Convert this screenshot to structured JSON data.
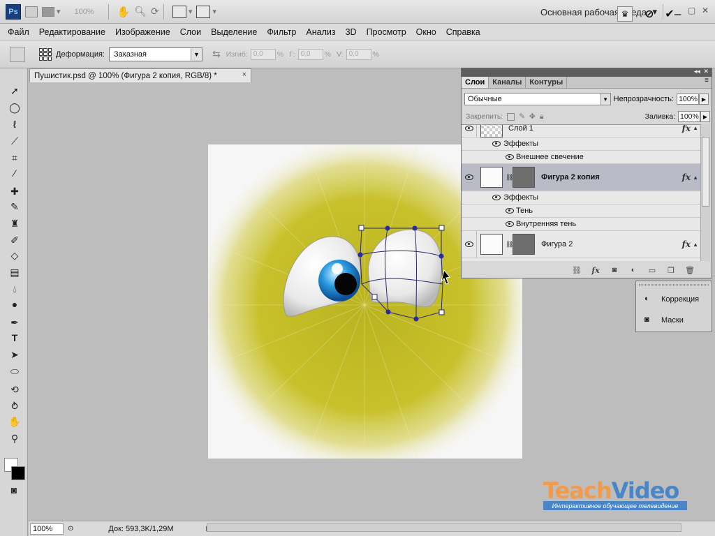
{
  "app": {
    "logo": "Ps",
    "zoom": "100%",
    "workspace": "Основная рабочая среда"
  },
  "menu": [
    "Файл",
    "Редактирование",
    "Изображение",
    "Слои",
    "Выделение",
    "Фильтр",
    "Анализ",
    "3D",
    "Просмотр",
    "Окно",
    "Справка"
  ],
  "options": {
    "deform_label": "Деформация:",
    "deform_value": "Заказная",
    "bend_label": "Изгиб:",
    "bend_value": "0,0",
    "h_label": "Г:",
    "h_value": "0,0",
    "v_label": "V:",
    "v_value": "0,0",
    "pct": "%"
  },
  "document": {
    "tab_title": "Пушистик.psd @ 100% (Фигура 2 копия, RGB/8) *",
    "close": "×"
  },
  "status": {
    "zoom": "100%",
    "doc_info": "Док: 593,3K/1,29M"
  },
  "layers_panel": {
    "tabs": [
      "Слои",
      "Каналы",
      "Контуры"
    ],
    "blend_mode": "Обычные",
    "opacity_label": "Непрозрачность:",
    "opacity_value": "100%",
    "lock_label": "Закрепить:",
    "fill_label": "Заливка:",
    "fill_value": "100%",
    "fx": "fx",
    "rows": {
      "layer1": "Слой 1",
      "effects1": "Эффекты",
      "outer_glow": "Внешнее свечение",
      "shape2copy": "Фигура 2 копия",
      "effects2": "Эффекты",
      "shadow": "Тень",
      "inner_shadow": "Внутренняя тень",
      "shape2": "Фигура 2"
    }
  },
  "side_panel": {
    "adjustments": "Коррекция",
    "masks": "Маски"
  },
  "watermark": {
    "teach": "Teach",
    "video": "Video",
    "subtitle": "Интерактивное обучающее телевидение"
  },
  "colors": {
    "fur": "#c9c227",
    "selected_layer": "#b9bcc7",
    "warp_handles": "#2a2aa0"
  }
}
